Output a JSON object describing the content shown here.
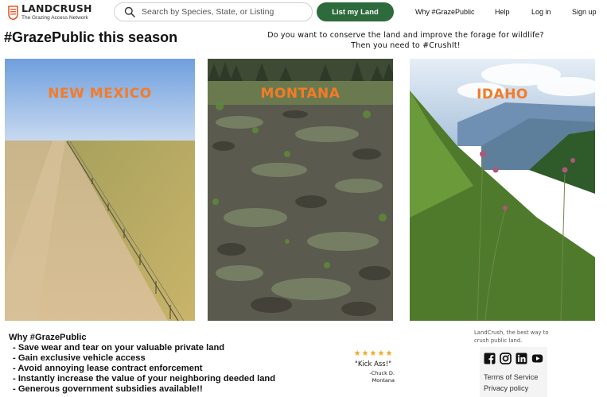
{
  "header": {
    "logo": {
      "name": "LANDCRUSH",
      "tagline": "The Grazing Access Network"
    },
    "search": {
      "placeholder": "Search by Species, State, or Listing"
    },
    "list_button": "List my Land",
    "nav": [
      "Why #GrazePublic",
      "Help",
      "Log in",
      "Sign up"
    ]
  },
  "hero": {
    "title": "#GrazePublic this season",
    "tagline_line1": "Do you want to conserve the land and improve the forage for wildlife?",
    "tagline_line2": "Then you need to #CrushIt!"
  },
  "photos": [
    {
      "label": "NEW MEXICO",
      "scene": "flat desert rangeland with fence line"
    },
    {
      "label": "MONTANA",
      "scene": "trampled muddy field"
    },
    {
      "label": "IDAHO",
      "scene": "green mountain slope with thistles"
    }
  ],
  "why": {
    "title": "Why #GrazePublic",
    "items": [
      "- Save wear and tear on your valuable private land",
      "- Gain exclusive vehicle access",
      "- Avoid annoying lease contract enforcement",
      "- Instantly increase the value of your neighboring deeded land",
      "- Generous government subsidies available!!"
    ]
  },
  "review": {
    "rating": 5,
    "quote": "\"Kick Ass!\"",
    "author": "-Chuck D.",
    "location": "Montana"
  },
  "footer": {
    "tagline": "LandCrush, the best way to crush public land.",
    "socials": [
      "facebook-icon",
      "instagram-icon",
      "linkedin-icon",
      "youtube-icon"
    ],
    "links": [
      "Terms of Service",
      "Privacy policy"
    ]
  },
  "colors": {
    "brand_green": "#2d6a3c",
    "accent_orange": "#f47b27",
    "star_gold": "#f5a623"
  }
}
